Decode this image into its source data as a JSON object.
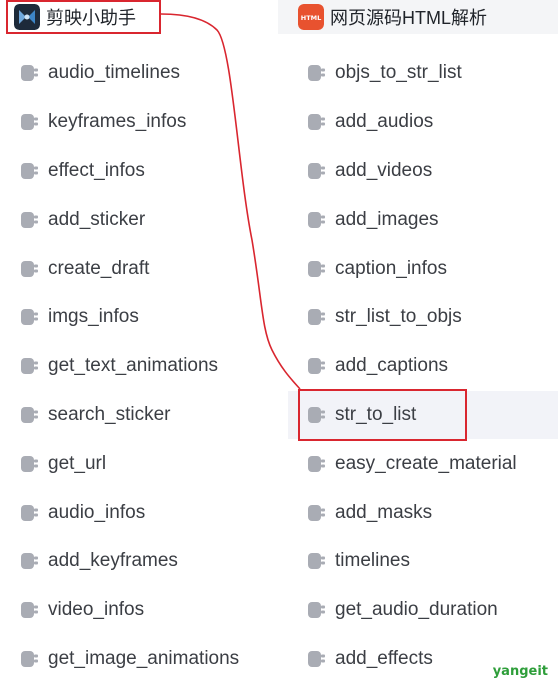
{
  "header": {
    "left_tab": {
      "label": "剪映小助手",
      "icon": "jianying-app-icon"
    },
    "right_tab": {
      "label": "网页源码HTML解析",
      "icon": "html-badge-icon",
      "icon_text": "HTML"
    }
  },
  "tools": {
    "left": [
      "audio_timelines",
      "keyframes_infos",
      "effect_infos",
      "add_sticker",
      "create_draft",
      "imgs_infos",
      "get_text_animations",
      "search_sticker",
      "get_url",
      "audio_infos",
      "add_keyframes",
      "video_infos",
      "get_image_animations"
    ],
    "right": [
      "objs_to_str_list",
      "add_audios",
      "add_videos",
      "add_images",
      "caption_infos",
      "str_list_to_objs",
      "add_captions",
      "str_to_list",
      "easy_create_material",
      "add_masks",
      "timelines",
      "get_audio_duration",
      "add_effects"
    ],
    "highlighted": "str_to_list"
  },
  "colors": {
    "annotation_red": "#d9262f",
    "icon_gray": "#a9acb4",
    "text": "#3b3e44",
    "highlight_bg": "#f2f3f8",
    "html_badge": "#e8522f",
    "watermark": "#2e9e3a"
  },
  "watermark": {
    "text": "yangeit"
  }
}
